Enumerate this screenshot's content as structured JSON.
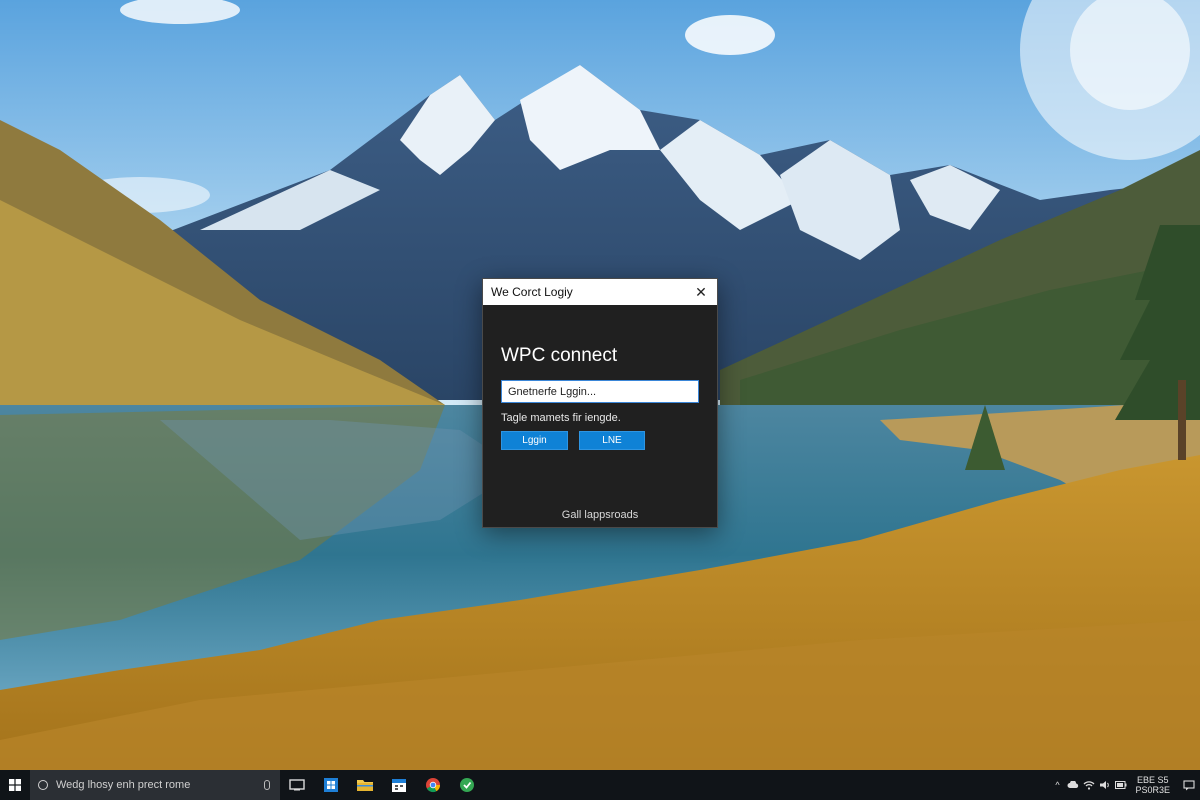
{
  "dialog": {
    "title": "We Corct Logiy",
    "close_glyph": "✕",
    "heading": "WPC connect",
    "input_value": "Gnetnerfe Lggin...",
    "hint": "Tagle mamets fir iengde.",
    "login_button": "Lggin",
    "link_button": "LNE",
    "footer_link": "Gall lappsroads"
  },
  "taskbar": {
    "search_text": "Wedg lhosy enh prect rome",
    "pinned_icons": [
      "task-view-icon",
      "store-icon",
      "file-explorer-icon",
      "calendar-icon",
      "chrome-icon",
      "app-icon"
    ],
    "tray": {
      "chevron": "^",
      "clock_line1": "EBE S5",
      "clock_line2": "PS0R3E"
    }
  },
  "colors": {
    "dialog_bg": "#202020",
    "accent": "#0f82d6",
    "taskbar_bg": "#101418"
  }
}
